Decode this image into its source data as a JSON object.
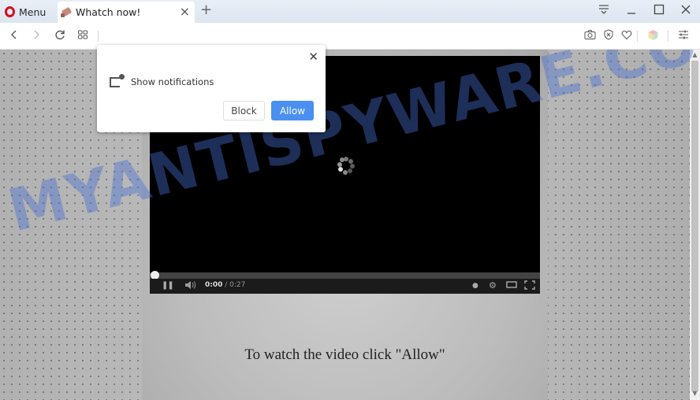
{
  "browser": {
    "menu_label": "Menu",
    "tab_title": "Whatch now!",
    "new_tab_symbol": "+",
    "tab_close_symbol": "×",
    "window_controls": {
      "tab_menu": "⩡",
      "minimize": "_",
      "maximize": "☐",
      "close": "✕"
    },
    "address_value": "",
    "toolbar_icons": {
      "back": "‹",
      "forward": "›",
      "reload": "↻",
      "speed_dial": "⊞",
      "snapshot": "📷",
      "adblock": "⊗",
      "bookmark": "♡",
      "extension": "⬢",
      "easy_setup": "☰"
    }
  },
  "notification": {
    "text": "Show notifications",
    "block_label": "Block",
    "allow_label": "Allow",
    "close_symbol": "✕",
    "accent_color": "#4b8ff0"
  },
  "video": {
    "time_current": "0:00",
    "time_total": " / 0:27",
    "progress": 0,
    "controls": {
      "pause": "❚❚",
      "volume": "🔈",
      "info": "●",
      "settings": "⚙",
      "theater": "▭",
      "fullscreen": "⛶"
    }
  },
  "page": {
    "cta_text": "To watch the video click \"Allow\""
  },
  "watermark": {
    "text": "MYANTISPYWARE.COM",
    "color": "#466ed2"
  },
  "scrollbar": {
    "up": "▲",
    "down": "▼"
  }
}
